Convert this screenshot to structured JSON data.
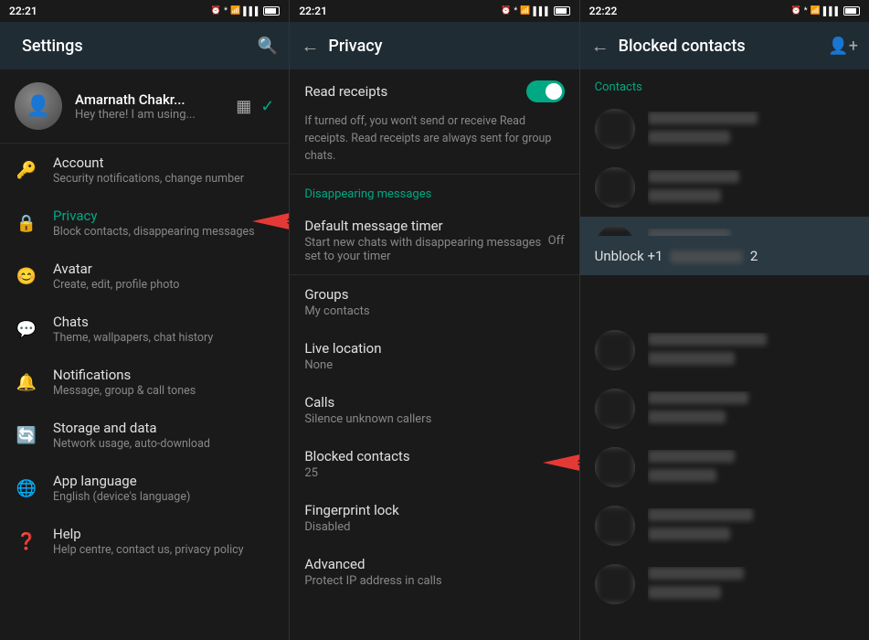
{
  "panels": [
    {
      "id": "settings",
      "statusBar": {
        "time": "22:21"
      },
      "header": {
        "title": "Settings",
        "hasBack": false,
        "hasSearch": true
      },
      "profile": {
        "name": "Amarnath Chakr...",
        "status": "Hey there! I am using..."
      },
      "items": [
        {
          "id": "account",
          "icon": "🔑",
          "title": "Account",
          "subtitle": "Security notifications, change number",
          "active": false,
          "hasArrow": false
        },
        {
          "id": "privacy",
          "icon": "🔒",
          "title": "Privacy",
          "subtitle": "Block contacts, disappearing messages",
          "active": true,
          "hasArrow": true
        },
        {
          "id": "avatar",
          "icon": "😊",
          "title": "Avatar",
          "subtitle": "Create, edit, profile photo",
          "active": false,
          "hasArrow": false
        },
        {
          "id": "chats",
          "icon": "💬",
          "title": "Chats",
          "subtitle": "Theme, wallpapers, chat history",
          "active": false,
          "hasArrow": false
        },
        {
          "id": "notifications",
          "icon": "🔔",
          "title": "Notifications",
          "subtitle": "Message, group & call tones",
          "active": false,
          "hasArrow": false
        },
        {
          "id": "storage",
          "icon": "🔄",
          "title": "Storage and data",
          "subtitle": "Network usage, auto-download",
          "active": false,
          "hasArrow": false
        },
        {
          "id": "language",
          "icon": "🌐",
          "title": "App language",
          "subtitle": "English (device's language)",
          "active": false,
          "hasArrow": false
        },
        {
          "id": "help",
          "icon": "❓",
          "title": "Help",
          "subtitle": "Help centre, contact us, privacy policy",
          "active": false,
          "hasArrow": false
        }
      ]
    },
    {
      "id": "privacy",
      "statusBar": {
        "time": "22:21"
      },
      "header": {
        "title": "Privacy",
        "hasBack": true,
        "hasSearch": false
      },
      "sections": [
        {
          "items": [
            {
              "id": "read-receipts",
              "title": "Read receipts",
              "subtitle": "If turned off, you won't send or receive Read receipts. Read receipts are always sent for group chats.",
              "type": "toggle",
              "value": true
            }
          ]
        },
        {
          "label": "Disappearing messages",
          "items": [
            {
              "id": "default-timer",
              "title": "Default message timer",
              "subtitle": "Start new chats with disappearing messages set to your timer",
              "type": "value",
              "value": "Off"
            }
          ]
        },
        {
          "items": [
            {
              "id": "groups",
              "title": "Groups",
              "subtitle": "My contacts",
              "type": "none"
            },
            {
              "id": "live-location",
              "title": "Live location",
              "subtitle": "None",
              "type": "none"
            },
            {
              "id": "calls",
              "title": "Calls",
              "subtitle": "Silence unknown callers",
              "type": "none"
            },
            {
              "id": "blocked-contacts",
              "title": "Blocked contacts",
              "subtitle": "25",
              "type": "arrow",
              "hasArrow": true
            },
            {
              "id": "fingerprint-lock",
              "title": "Fingerprint lock",
              "subtitle": "Disabled",
              "type": "none"
            },
            {
              "id": "advanced",
              "title": "Advanced",
              "subtitle": "Protect IP address in calls",
              "type": "none"
            }
          ]
        }
      ]
    },
    {
      "id": "blocked",
      "statusBar": {
        "time": "22:22"
      },
      "header": {
        "title": "Blocked contacts",
        "hasBack": true,
        "hasAddUser": true
      },
      "contactsLabel": "Contacts",
      "unblock": {
        "text": "Unblock +1",
        "numberPlaceholder": "●●●●●●●●●●",
        "suffix": "2"
      },
      "contacts": [
        {
          "id": "c1",
          "nameWidth": "120px"
        },
        {
          "id": "c2",
          "nameWidth": "100px"
        },
        {
          "id": "c3",
          "nameWidth": "90px"
        },
        {
          "id": "c4",
          "nameWidth": "130px"
        },
        {
          "id": "c5",
          "nameWidth": "110px"
        },
        {
          "id": "c6",
          "nameWidth": "95px"
        },
        {
          "id": "c7",
          "nameWidth": "115px"
        },
        {
          "id": "c8",
          "nameWidth": "105px"
        }
      ]
    }
  ]
}
